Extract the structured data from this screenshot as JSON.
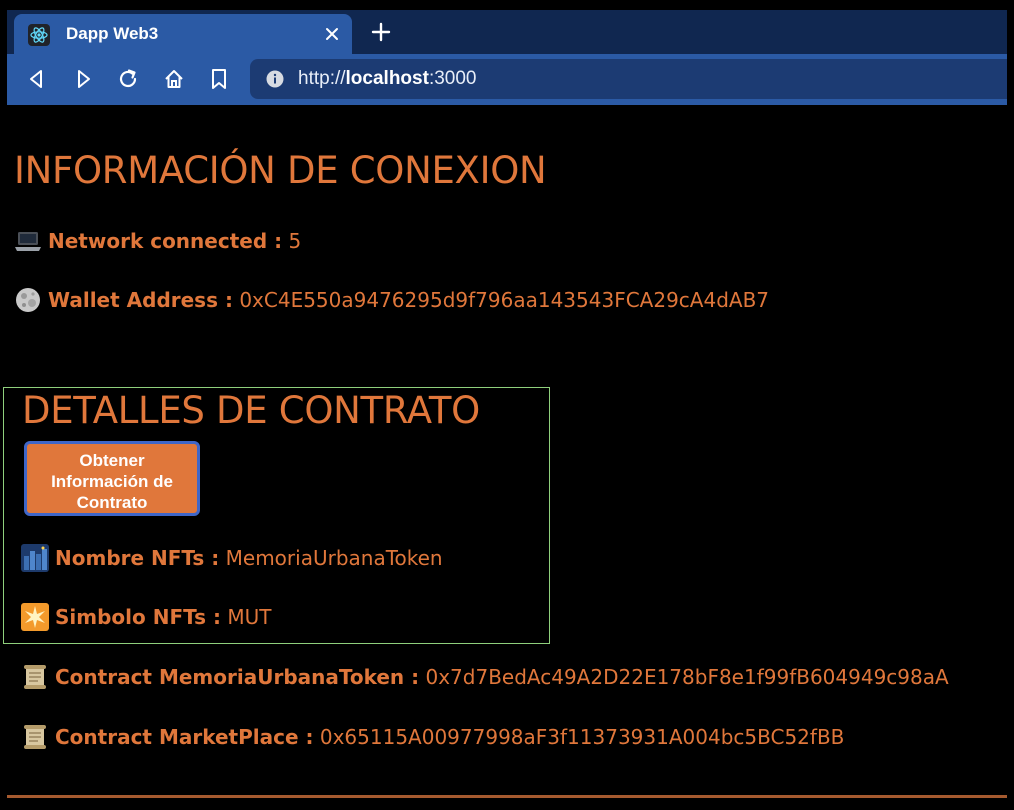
{
  "browser": {
    "tab_title": "Dapp Web3",
    "url_scheme": "http://",
    "url_host": "localhost",
    "url_port": ":3000"
  },
  "connection": {
    "heading": "INFORMACIÓN DE CONEXION",
    "network_label": "Network connected :",
    "network_value": "5",
    "wallet_label": "Wallet Address :",
    "wallet_value": "0xC4E550a9476295d9f796aa143543FCA29cA4dAB7"
  },
  "contract": {
    "heading": "DETALLES DE CONTRATO",
    "button_label": "Obtener Información de Contrato",
    "name_label": "Nombre NFTs :",
    "name_value": "MemoriaUrbanaToken",
    "symbol_label": "Simbolo NFTs :",
    "symbol_value": "MUT",
    "token_label": "Contract MemoriaUrbanaToken :",
    "token_value": "0x7d7BedAc49A2D22E178bF8e1f99fB604949c98aA",
    "market_label": "Contract MarketPlace :",
    "market_value": "0x65115A00977998aF3f11373931A004bc5BC52fBB"
  },
  "colors": {
    "accent": "#e0773b",
    "background": "#000000",
    "chrome": "#2b5aa5",
    "box_border": "#8fd07c"
  },
  "icons": {
    "network": "laptop-icon",
    "wallet": "moon-icon",
    "name": "night-city-icon",
    "symbol": "sparkle-icon",
    "contract": "scroll-icon"
  }
}
